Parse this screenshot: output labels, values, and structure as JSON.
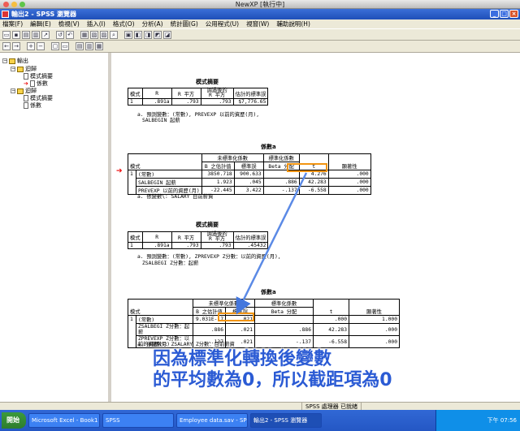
{
  "mac": {
    "title": "NewXP [執行中]"
  },
  "window": {
    "title": "輸出2 - SPSS 瀏覽器"
  },
  "menu": [
    "檔案(F)",
    "編輯(E)",
    "檢視(V)",
    "插入(I)",
    "格式(O)",
    "分析(A)",
    "統計圖(G)",
    "公用程式(U)",
    "視窗(W)",
    "輔助說明(H)"
  ],
  "tree": {
    "root": "輸出",
    "n1": "迴歸",
    "n1a": "模式摘要",
    "n1b": "係數",
    "n2": "迴歸",
    "n2a": "模式摘要",
    "n2b": "係數"
  },
  "t1": {
    "title": "模式摘要",
    "h": [
      "模式",
      "R",
      "R 平方",
      "調過後的\nR 平方",
      "估計的標準誤"
    ],
    "row": [
      "1",
      ".891a",
      ".793",
      ".793",
      "$7,776.65"
    ],
    "note1": "a. 預測變數：(常數), PREVEXP 以前的資歷(月),",
    "note2": "SALBEGIN 起薪"
  },
  "t2": {
    "title": "係數a",
    "hgroup1": "未標準化係數",
    "hgroup2": "標準化係數",
    "h": [
      "模式",
      "",
      "B 之估計值",
      "標準誤",
      "Beta 分配",
      "t",
      "顯著性"
    ],
    "rows": [
      [
        "1",
        "(常數)",
        "3850.718",
        "900.633",
        "",
        "4.276",
        ".000"
      ],
      [
        "",
        "SALBEGIN 起薪",
        "1.923",
        ".045",
        ".886",
        "42.283",
        ".000"
      ],
      [
        "",
        "PREVEXP 以前的資歷(月)",
        "-22.445",
        "3.422",
        "-.137",
        "-6.558",
        ".000"
      ]
    ],
    "note": "a. 依變數\\: SALARY 目前薪資"
  },
  "t3": {
    "title": "模式摘要",
    "h": [
      "模式",
      "R",
      "R 平方",
      "調過後的\nR 平方",
      "估計的標準誤"
    ],
    "row": [
      "1",
      ".891a",
      ".793",
      ".793",
      ".45432"
    ],
    "note1": "a. 預測變數：(常數), ZPREVEXP Z分數：以前的資歷(月),",
    "note2": "ZSALBEGI Z分數：起薪"
  },
  "t4": {
    "title": "係數a",
    "hgroup1": "未標準化係數",
    "hgroup2": "標準化係數",
    "h": [
      "模式",
      "",
      "B 之估計值",
      "標準誤",
      "Beta 分配",
      "t",
      "顯著性"
    ],
    "rows": [
      [
        "1",
        "(常數)",
        "9.031E-17",
        ".021",
        "",
        ".000",
        "1.000"
      ],
      [
        "",
        "ZSALBEGI Z分數：起薪",
        ".886",
        ".021",
        ".886",
        "42.283",
        ".000"
      ],
      [
        "",
        "ZPREVEXP Z分數：以前的資歷(月)",
        "-.137",
        ".021",
        "-.137",
        "-6.558",
        ".000"
      ]
    ],
    "note": "a. 依變數\\: ZSALARY Z分數：目前薪資"
  },
  "caption": {
    "line1": "因為標準化轉換後變數",
    "line2": "的平均數為0，所以截距項為0"
  },
  "status": {
    "processor": "SPSS 處理器 已就緒"
  },
  "taskbar": {
    "start": "開始",
    "tasks": [
      "Microsoft Excel - Book1",
      "SPSS",
      "Employee data.sav - SPSS...",
      "輸出2 - SPSS 瀏覽器"
    ],
    "clock": "下午 07:56"
  }
}
